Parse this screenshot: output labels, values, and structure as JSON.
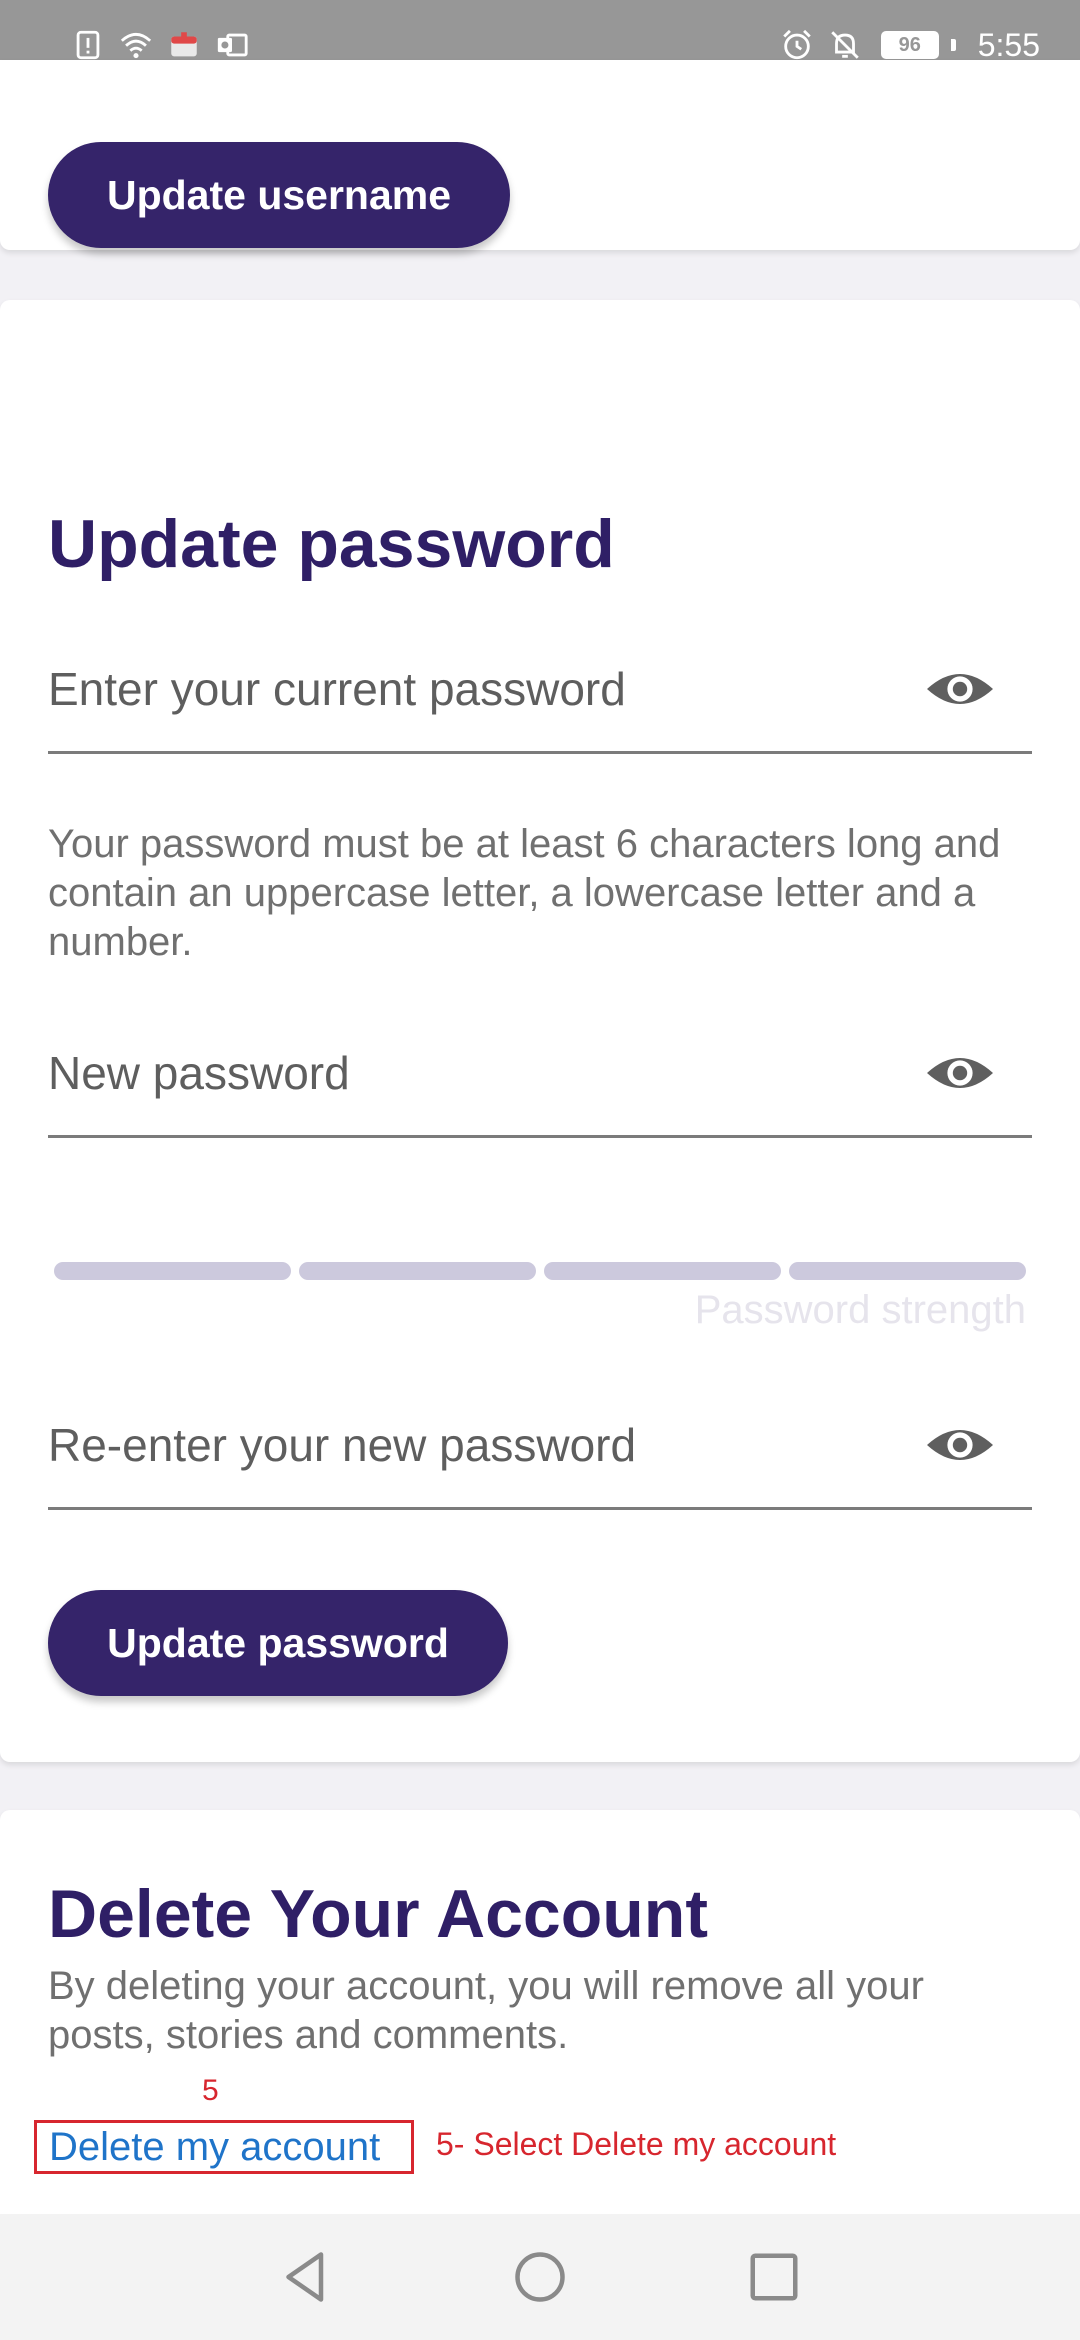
{
  "status_bar": {
    "battery_level": "96",
    "time": "5:55",
    "left_icons": [
      "alert-icon",
      "wifi-icon",
      "app-icon",
      "outlook-icon"
    ],
    "right_icons": [
      "alarm-icon",
      "mute-icon"
    ]
  },
  "username_section": {
    "button_label": "Update username"
  },
  "password_section": {
    "title": "Update password",
    "current_password_placeholder": "Enter your current password",
    "hint": "Your password must be at least 6 characters long and contain an uppercase letter, a lowercase letter and a number.",
    "new_password_placeholder": "New password",
    "strength_label": "Password strength",
    "strength_level": 0,
    "confirm_password_placeholder": "Re-enter your new password",
    "button_label": "Update password"
  },
  "delete_section": {
    "title": "Delete Your Account",
    "description": "By deleting your account, you will remove all your posts, stories and comments.",
    "link_label": "Delete my account"
  },
  "annotation": {
    "step_number": "5",
    "step_text": "5- Select Delete my account",
    "color": "#d7262e"
  },
  "colors": {
    "accent": "#35246a",
    "title": "#2f1f66",
    "link": "#1f74c9"
  }
}
